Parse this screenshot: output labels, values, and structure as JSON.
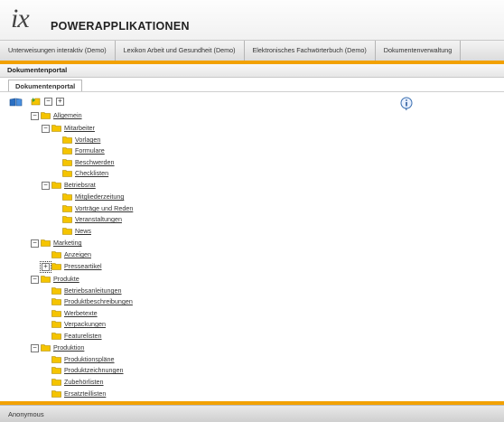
{
  "header": {
    "logo": "ix",
    "title": "POWERAPPLIKATIONEN"
  },
  "nav": [
    "Unterweisungen interaktiv (Demo)",
    "Lexikon Arbeit und Gesundheit (Demo)",
    "Elektronisches Fachwörterbuch (Demo)",
    "Dokumentenverwaltung"
  ],
  "portal": {
    "label": "Dokumentenportal",
    "tab": "Dokumentenportal"
  },
  "toolbar": {
    "collapse_symbol": "⊟",
    "expand_symbol": "⊞"
  },
  "tree": {
    "allgemein": "Allgemein",
    "mitarbeiter": "Mitarbeiter",
    "vorlagen": "Vorlagen",
    "formulare": "Formulare",
    "beschwerden": "Beschwerden",
    "checklisten": "Checklisten",
    "betriebsrat": "Betriebsrat",
    "mitgliederzeitung": "Mitgliederzeitung",
    "vortraege": "Vorträge und Reden",
    "veranstaltungen": "Veranstaltungen",
    "news": "News",
    "marketing": "Marketing",
    "anzeigen": "Anzeigen",
    "presseartikel": "Presseartikel",
    "produkte": "Produkte",
    "betriebsanleitungen": "Betriebsanleitungen",
    "produktbeschreibungen": "Produktbeschreibungen",
    "werbetexte": "Werbetexte",
    "verpackungen": "Verpackungen",
    "featurelisten": "Featurelisten",
    "produktion": "Produktion",
    "produktionsplaene": "Produktionspläne",
    "produktzeichnungen": "Produktzeichnungen",
    "zubehoerlisten": "Zubehörlisten",
    "ersatzteillisten": "Ersatzteillisten",
    "minus": "−",
    "plus": "+"
  },
  "footer": {
    "user": "Anonymous"
  },
  "colors": {
    "accent": "#f2a100",
    "folder": "#f5c400"
  }
}
